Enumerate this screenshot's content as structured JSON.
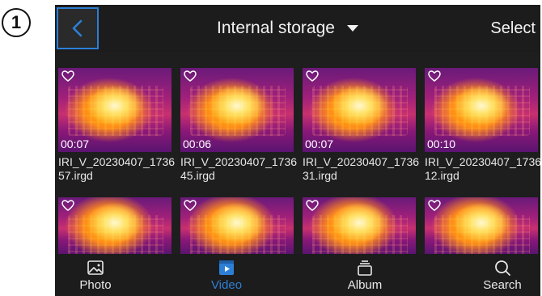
{
  "step_badge": "1",
  "header": {
    "title": "Internal storage",
    "select_label": "Select"
  },
  "videos": [
    {
      "duration": "00:07",
      "filename": "IRI_V_20230407_173657.irgd"
    },
    {
      "duration": "00:06",
      "filename": "IRI_V_20230407_173645.irgd"
    },
    {
      "duration": "00:07",
      "filename": "IRI_V_20230407_173631.irgd"
    },
    {
      "duration": "00:10",
      "filename": "IRI_V_20230407_173612.irgd"
    }
  ],
  "nav": {
    "items": [
      {
        "label": "Photo",
        "icon": "photo-icon"
      },
      {
        "label": "Video",
        "icon": "video-icon",
        "active": true
      },
      {
        "label": "Album",
        "icon": "album-icon"
      },
      {
        "label": "Search",
        "icon": "search-icon"
      }
    ]
  },
  "colors": {
    "accent": "#2d7fd6",
    "background": "#1e1e1e"
  }
}
